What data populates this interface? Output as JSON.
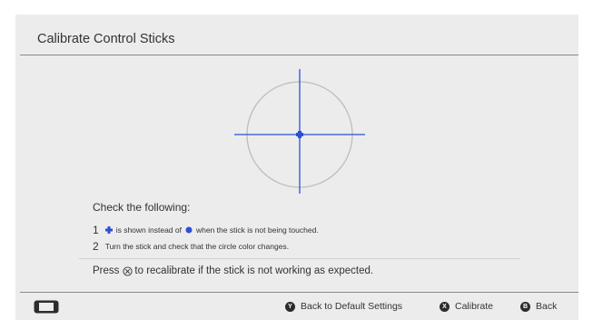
{
  "header": {
    "title": "Calibrate Control Sticks"
  },
  "instructions": {
    "heading": "Check the following:",
    "steps": [
      {
        "num": "1",
        "text_before": "is shown instead of",
        "text_after": "when the stick is not being touched.",
        "icon_cross": "plus-marker-icon",
        "icon_dot": "dot-marker-icon"
      },
      {
        "num": "2",
        "text": "Turn the stick and check that the circle color changes."
      }
    ],
    "note_before": "Press",
    "note_after": "to recalibrate if the stick is not working as expected.",
    "note_icon": "x-button-icon"
  },
  "footer": {
    "console_icon": "console-icon",
    "buttons": [
      {
        "glyph": "Y",
        "label": "Back to Default Settings"
      },
      {
        "glyph": "X",
        "label": "Calibrate"
      },
      {
        "glyph": "B",
        "label": "Back"
      }
    ]
  },
  "colors": {
    "accent_blue": "#2d4fd6",
    "panel_bg": "#ececec",
    "circle_gray": "#bdbdbd"
  }
}
